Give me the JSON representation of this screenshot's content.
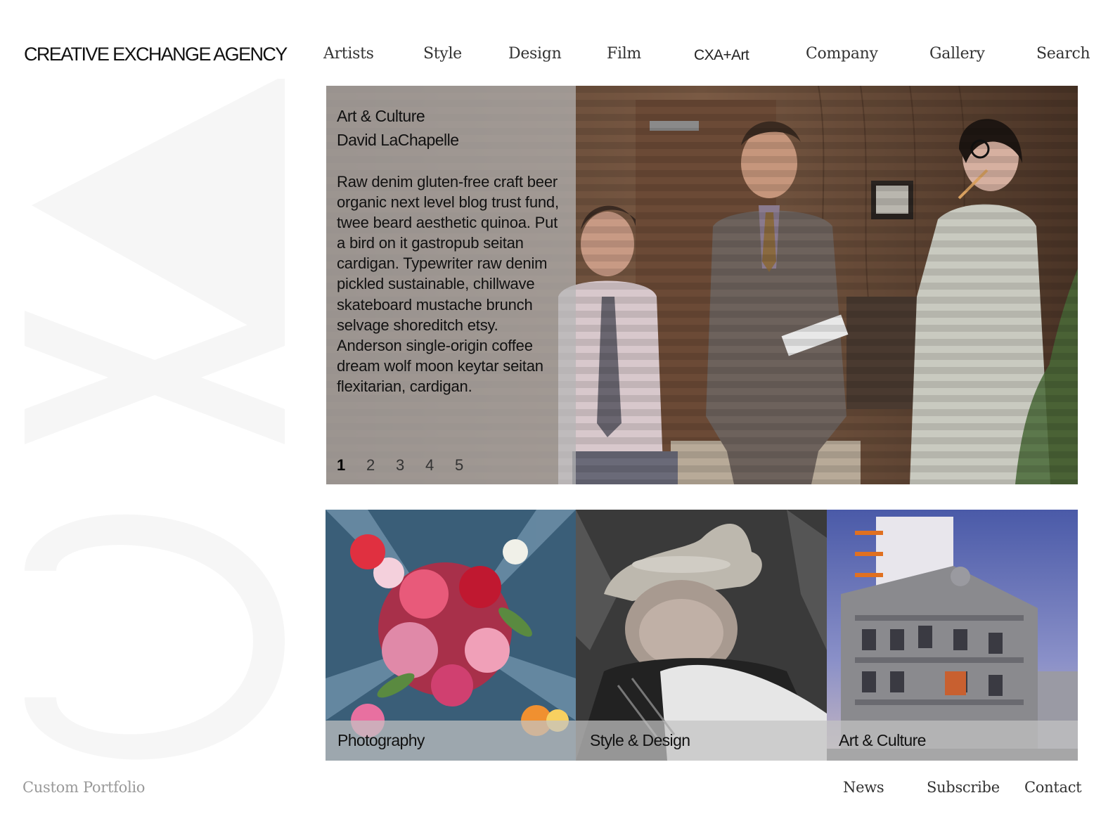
{
  "brand": {
    "name": "CREATIVE EXCHANGE AGENCY",
    "watermark": "CXA"
  },
  "nav": {
    "artists": "Artists",
    "style": "Style",
    "design": "Design",
    "film": "Film",
    "cxa_art": "CXA+Art",
    "company": "Company",
    "gallery": "Gallery",
    "search": "Search"
  },
  "hero": {
    "kicker": "Art & Culture",
    "author": "David LaChapelle",
    "body": "Raw denim gluten-free craft beer organic next level blog trust fund, twee beard aesthetic quinoa. Put a bird on it gastropub seitan cardigan. Typewriter raw denim pickled sustainable, chillwave skateboard mustache brunch selvage shoreditch etsy. Anderson single-origin coffee dream wolf moon keytar seitan flexitarian, cardigan.",
    "pages": [
      "1",
      "2",
      "3",
      "4",
      "5"
    ],
    "active_page": "1"
  },
  "tiles": {
    "photography": "Photography",
    "style_design": "Style & Design",
    "art_culture": "Art & Culture"
  },
  "footer": {
    "tagline": "Custom Portfolio",
    "news": "News",
    "subscribe": "Subscribe",
    "contact": "Contact"
  }
}
